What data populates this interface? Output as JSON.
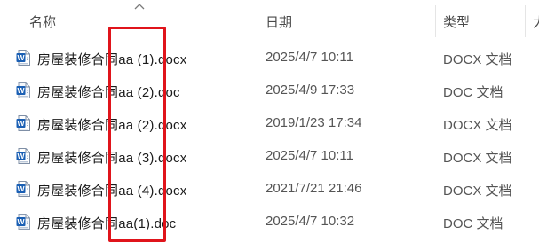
{
  "columns": {
    "name": "名称",
    "date": "日期",
    "type": "类型",
    "size": "大"
  },
  "files": [
    {
      "name": "房屋装修合同aa (1).docx",
      "date": "2025/4/7 10:11",
      "type": "DOCX 文档",
      "icon": "word-docx-icon"
    },
    {
      "name": "房屋装修合同aa (2).doc",
      "date": "2025/4/9 17:33",
      "type": "DOC 文档",
      "icon": "word-doc-icon"
    },
    {
      "name": "房屋装修合同aa (2).docx",
      "date": "2019/1/23 17:34",
      "type": "DOCX 文档",
      "icon": "word-docx-icon"
    },
    {
      "name": "房屋装修合同aa (3).docx",
      "date": "2025/4/7 10:11",
      "type": "DOCX 文档",
      "icon": "word-docx-icon"
    },
    {
      "name": "房屋装修合同aa (4).docx",
      "date": "2021/7/21 21:46",
      "type": "DOCX 文档",
      "icon": "word-docx-icon"
    },
    {
      "name": "房屋装修合同aa(1).doc",
      "date": "2025/4/7 10:32",
      "type": "DOC 文档",
      "icon": "word-doc-icon"
    }
  ],
  "colors": {
    "annotation": "#e0141b",
    "word_blue": "#1a5fb4"
  }
}
